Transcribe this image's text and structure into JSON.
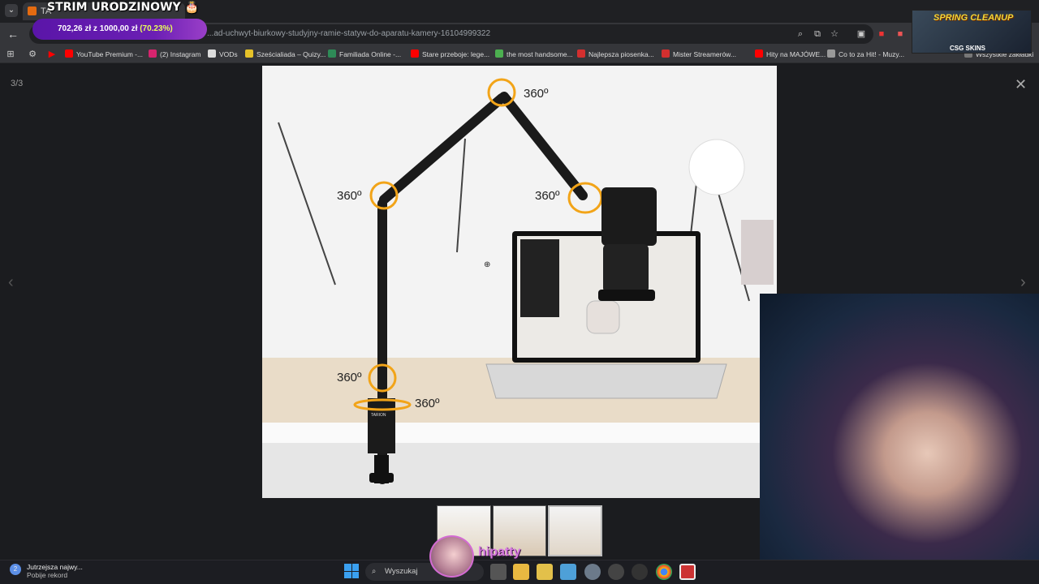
{
  "stream": {
    "banner_title": "STRIM URODZINOWY",
    "donation_goal": {
      "amount": "702,26 zł z 1000,00 zł",
      "percent": "(70.23%)"
    },
    "overlay": {
      "title": "SPRING CLEANUP",
      "sponsor": "CSG SKINS"
    },
    "handle": "hipatty"
  },
  "browser": {
    "tab_title": "TA",
    "url": "...ad-uchwyt-biurkowy-studyjny-ramie-statyw-do-aparatu-kamery-16104999322",
    "bookmarks": [
      {
        "label": "YouTube Premium -...",
        "color": "#ff0000"
      },
      {
        "label": "(2) Instagram",
        "color": "#d6246e"
      },
      {
        "label": "VODs",
        "color": "#dddddd"
      },
      {
        "label": "Sześcialiada – Quizy...",
        "color": "#e6c229"
      },
      {
        "label": "Familiada Online -...",
        "color": "#2e8b57"
      },
      {
        "label": "Stare przeboje: lege...",
        "color": "#ff0000"
      },
      {
        "label": "the most handsome...",
        "color": "#4caf50"
      },
      {
        "label": "Najlepsza piosenka...",
        "color": "#d32f2f"
      },
      {
        "label": "Mister Streamerów...",
        "color": "#d32f2f"
      },
      {
        "label": "Hity na MAJÓWE...",
        "color": "#ff0000"
      },
      {
        "label": "Co to za Hit! - Muzy...",
        "color": "#999999"
      }
    ],
    "bookmarks_all": "Wszystkie zakładki"
  },
  "viewer": {
    "counter": "3/3",
    "rotation_labels": [
      "360º",
      "360º",
      "360º",
      "360º",
      "360º"
    ],
    "brand": "TARION"
  },
  "taskbar": {
    "notification_title": "Jutrzejsza najwy...",
    "notification_sub": "Pobije rekord",
    "search_placeholder": "Wyszukaj"
  }
}
